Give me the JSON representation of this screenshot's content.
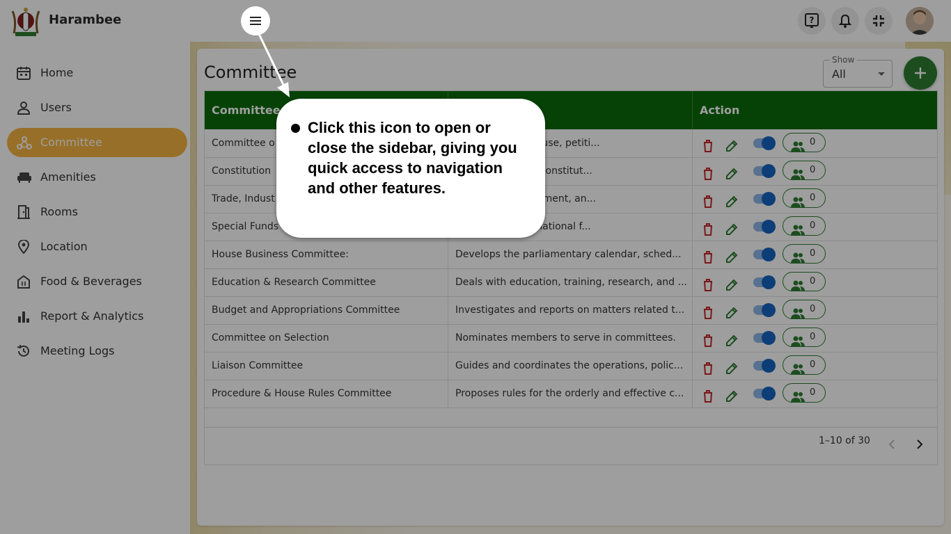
{
  "app": {
    "name": "Harambee"
  },
  "topbar": {
    "icons": [
      "help-icon",
      "bell-icon",
      "collapse-fullscreen-icon"
    ]
  },
  "sidebar": {
    "items": [
      {
        "label": "Home",
        "icon": "calendar-icon"
      },
      {
        "label": "Users",
        "icon": "person-icon"
      },
      {
        "label": "Committee",
        "icon": "committee-icon",
        "active": true
      },
      {
        "label": "Amenities",
        "icon": "sofa-icon"
      },
      {
        "label": "Rooms",
        "icon": "door-icon"
      },
      {
        "label": "Location",
        "icon": "location-pin-icon"
      },
      {
        "label": "Food & Beverages",
        "icon": "restaurant-icon"
      },
      {
        "label": "Report & Analytics",
        "icon": "bar-chart-icon"
      },
      {
        "label": "Meeting Logs",
        "icon": "history-icon"
      }
    ]
  },
  "main": {
    "title": "Committee",
    "show": {
      "legend": "Show",
      "value": "All"
    },
    "table": {
      "headers": [
        "Committee N",
        "",
        "Action"
      ],
      "rows": [
        {
          "name": "Committee o",
          "description": "olutions of the House, petiti...",
          "members": "0"
        },
        {
          "name": "Constitution",
          "description": "mentation of the constitut...",
          "members": "0"
        },
        {
          "name": "Trade, Indust",
          "description": "industrial development, an...",
          "members": "0"
        },
        {
          "name": "Special Funds",
          "description": "and accounts of national f...",
          "members": "0"
        },
        {
          "name": "House Business Committee:",
          "description": "Develops the parliamentary calendar, sched...",
          "members": "0"
        },
        {
          "name": "Education & Research Committee",
          "description": "Deals with education, training, research, and ...",
          "members": "0"
        },
        {
          "name": "Budget and Appropriations Committee",
          "description": "Investigates and reports on matters related t...",
          "members": "0"
        },
        {
          "name": "Committee on Selection",
          "description": "Nominates members to serve in committees.",
          "members": "0"
        },
        {
          "name": "Liaison Committee",
          "description": "Guides and coordinates the operations, polic...",
          "members": "0"
        },
        {
          "name": "Procedure & House Rules Committee",
          "description": "Proposes rules for the orderly and effective c...",
          "members": "0"
        }
      ]
    },
    "pagination": {
      "range": "1–10 of 30"
    }
  },
  "tutorial": {
    "text": "Click this icon to open or close the sidebar, giving you quick access to navigation and other features."
  },
  "colors": {
    "accent": "#f5b342",
    "header_green": "#0b6b0b",
    "fab_green": "#2e7d32",
    "delete_red": "#c62828",
    "toggle_blue": "#1565c0"
  }
}
